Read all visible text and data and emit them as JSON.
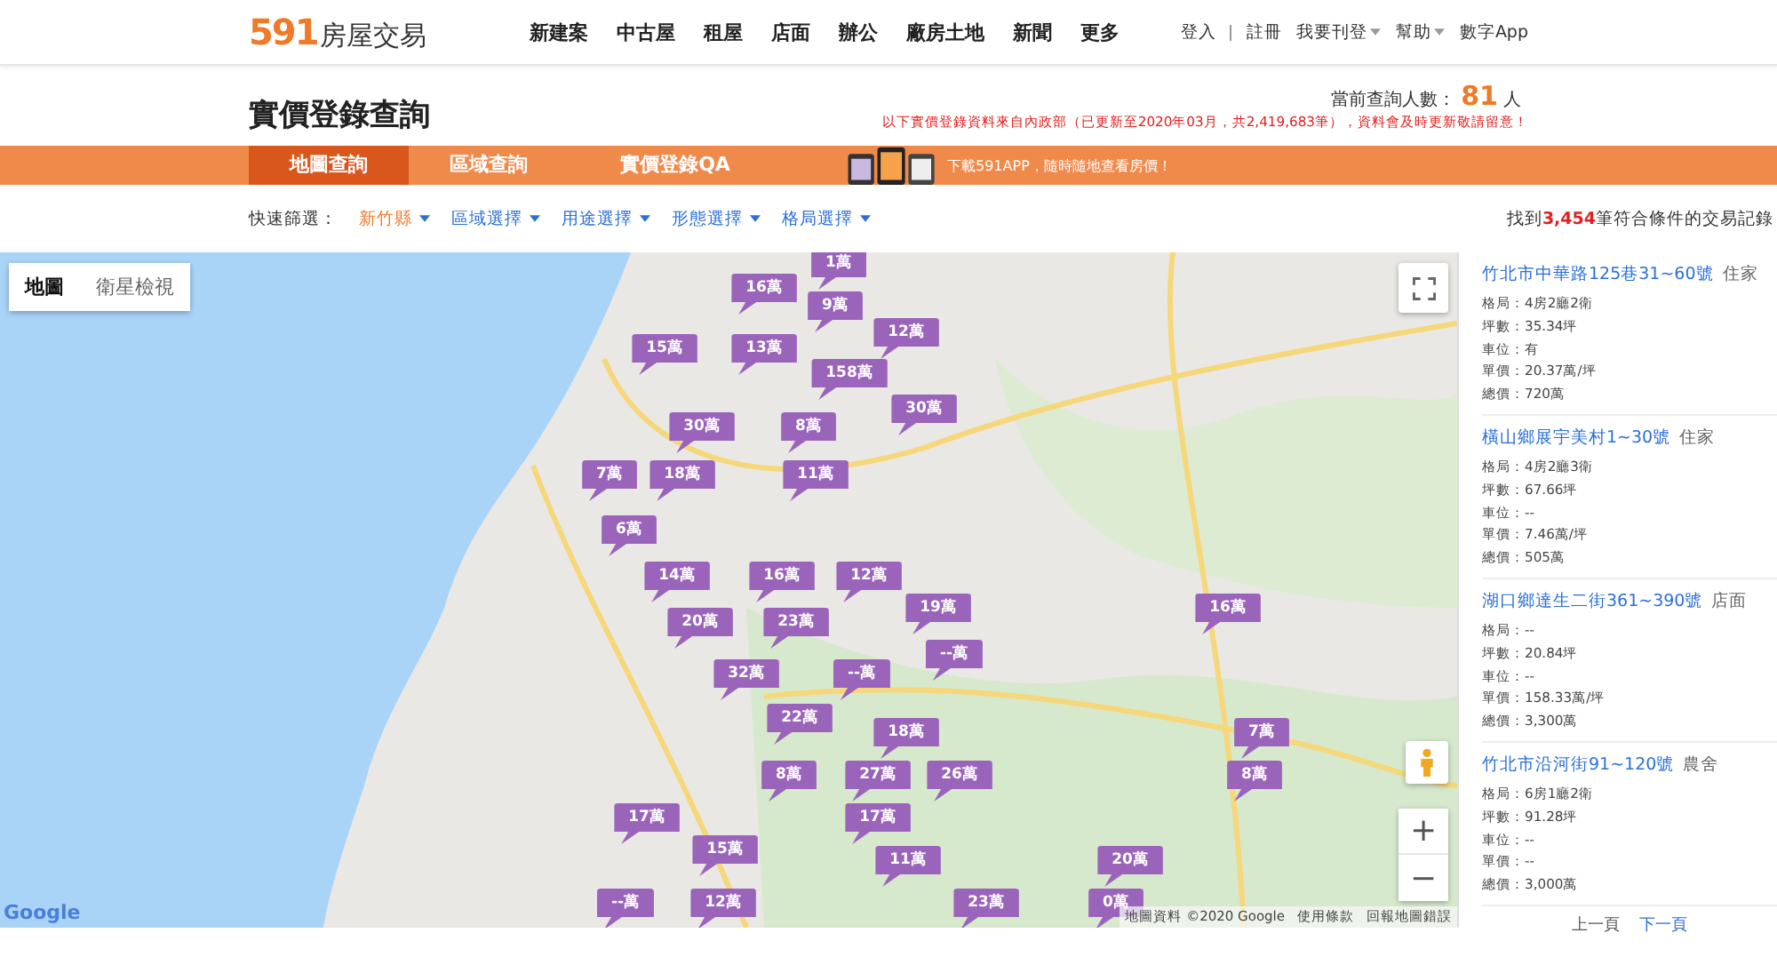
{
  "header": {
    "logo_number": "591",
    "logo_text": "房屋交易",
    "nav": [
      "新建案",
      "中古屋",
      "租屋",
      "店面",
      "辦公",
      "廠房土地",
      "新聞",
      "更多"
    ],
    "account": [
      {
        "label": "登入",
        "dropdown": false
      },
      {
        "label": "註冊",
        "dropdown": false
      },
      {
        "label": "我要刊登",
        "dropdown": true
      },
      {
        "label": "幫助",
        "dropdown": true
      },
      {
        "label": "數字App",
        "dropdown": false
      }
    ]
  },
  "title": "實價登錄查詢",
  "visitors": {
    "label": "當前查詢人數：",
    "count": "81",
    "unit": "人"
  },
  "notice": "以下實價登錄資料來自內政部（已更新至2020年03月，共2,419,683筆），資料會及時更新敬請留意！",
  "tabs": [
    {
      "label": "地圖查詢",
      "selected": true
    },
    {
      "label": "區域查詢",
      "selected": false
    },
    {
      "label": "實價登錄QA",
      "selected": false
    }
  ],
  "promo": "下載591APP，隨時隨地查看房價！",
  "filters": {
    "label": "快速篩選：",
    "items": [
      {
        "label": "新竹縣",
        "selected": true
      },
      {
        "label": "區域選擇",
        "selected": false
      },
      {
        "label": "用途選擇",
        "selected": false
      },
      {
        "label": "形態選擇",
        "selected": false
      },
      {
        "label": "格局選擇",
        "selected": false
      }
    ]
  },
  "result_count": "找到**3,454**筆符合條件的交易記錄",
  "map": {
    "types": [
      {
        "label": "地圖",
        "selected": true
      },
      {
        "label": "衛星檢視",
        "selected": false
      }
    ],
    "markers": [
      "1萬",
      "16萬",
      "9萬",
      "12萬",
      "15萬",
      "13萬",
      "158萬",
      "30萬",
      "30萬",
      "8萬",
      "7萬",
      "18萬",
      "11萬",
      "6萬",
      "14萬",
      "16萬",
      "12萬",
      "19萬",
      "16萬",
      "20萬",
      "23萬",
      "--萬",
      "32萬",
      "--萬",
      "22萬",
      "18萬",
      "7萬",
      "8萬",
      "27萬",
      "26萬",
      "8萬",
      "17萬",
      "17萬",
      "15萬",
      "11萬",
      "20萬",
      "--萬",
      "12萬",
      "23萬",
      "0萬"
    ],
    "google": "Google",
    "attribution": "地圖資料 ©2020 Google",
    "terms": "使用條款",
    "report": "回報地圖錯誤",
    "zoom_in": "+",
    "zoom_out": "−"
  },
  "listings": [
    {
      "title": "竹北市中華路125巷31~60號",
      "type": "住家",
      "fields": [
        "格局：4房2廳2衛",
        "坪數：35.34坪",
        "車位：有",
        "單價：20.37萬/坪",
        "總價：720萬"
      ]
    },
    {
      "title": "橫山鄉展宇美村1~30號",
      "type": "住家",
      "fields": [
        "格局：4房2廳3衛",
        "坪數：67.66坪",
        "車位：--",
        "單價：7.46萬/坪",
        "總價：505萬"
      ]
    },
    {
      "title": "湖口鄉達生二街361~390號",
      "type": "店面",
      "fields": [
        "格局：--",
        "坪數：20.84坪",
        "車位：--",
        "單價：158.33萬/坪",
        "總價：3,300萬"
      ]
    },
    {
      "title": "竹北市沿河街91~120號",
      "type": "農舍",
      "fields": [
        "格局：6房1廳2衛",
        "坪數：91.28坪",
        "車位：--",
        "單價：--",
        "總價：3,000萬"
      ]
    }
  ],
  "pager": [
    {
      "label": "上一頁",
      "disabled": true
    },
    {
      "label": "下一頁",
      "disabled": false
    }
  ]
}
